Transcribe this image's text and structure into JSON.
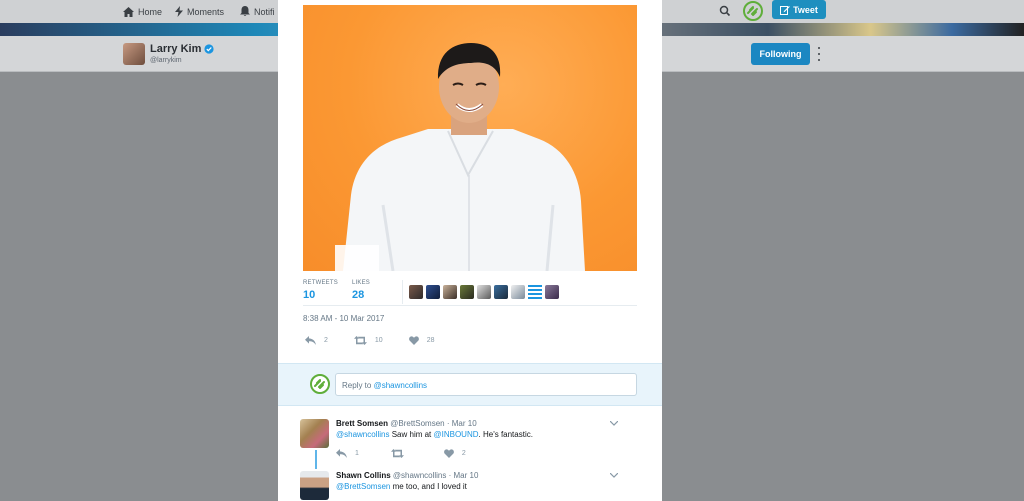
{
  "nav": {
    "home": "Home",
    "moments": "Moments",
    "notifications": "Notifi",
    "tweet_button": "Tweet"
  },
  "profile": {
    "name": "Larry Kim",
    "handle": "@larrykim",
    "following_button": "Following"
  },
  "tweet": {
    "retweets_label": "RETWEETS",
    "retweets_value": "10",
    "likes_label": "LIKES",
    "likes_value": "28",
    "timestamp": "8:38 AM - 10 Mar 2017",
    "actions": {
      "reply_count": "2",
      "retweet_count": "10",
      "like_count": "28"
    }
  },
  "reply_box": {
    "prefix": "Reply to ",
    "mention": "@shawncollins"
  },
  "replies": [
    {
      "name": "Brett Somsen",
      "handle": "@BrettSomsen",
      "date": "· Mar 10",
      "mention": "@shawncollins",
      "text_mid": " Saw him at ",
      "link": "@INBOUND",
      "text_end": ". He's fantastic.",
      "reply_count": "1",
      "retweet_count": "",
      "like_count": "2"
    },
    {
      "name": "Shawn Collins",
      "handle": "@shawncollins",
      "date": "· Mar 10",
      "mention": "@BrettSomsen",
      "text_end": " me too, and I loved it"
    }
  ],
  "colors": {
    "accent": "#1b95e0",
    "tweet_button": "#1e8fbf",
    "photo_bg": "#fb9833"
  }
}
